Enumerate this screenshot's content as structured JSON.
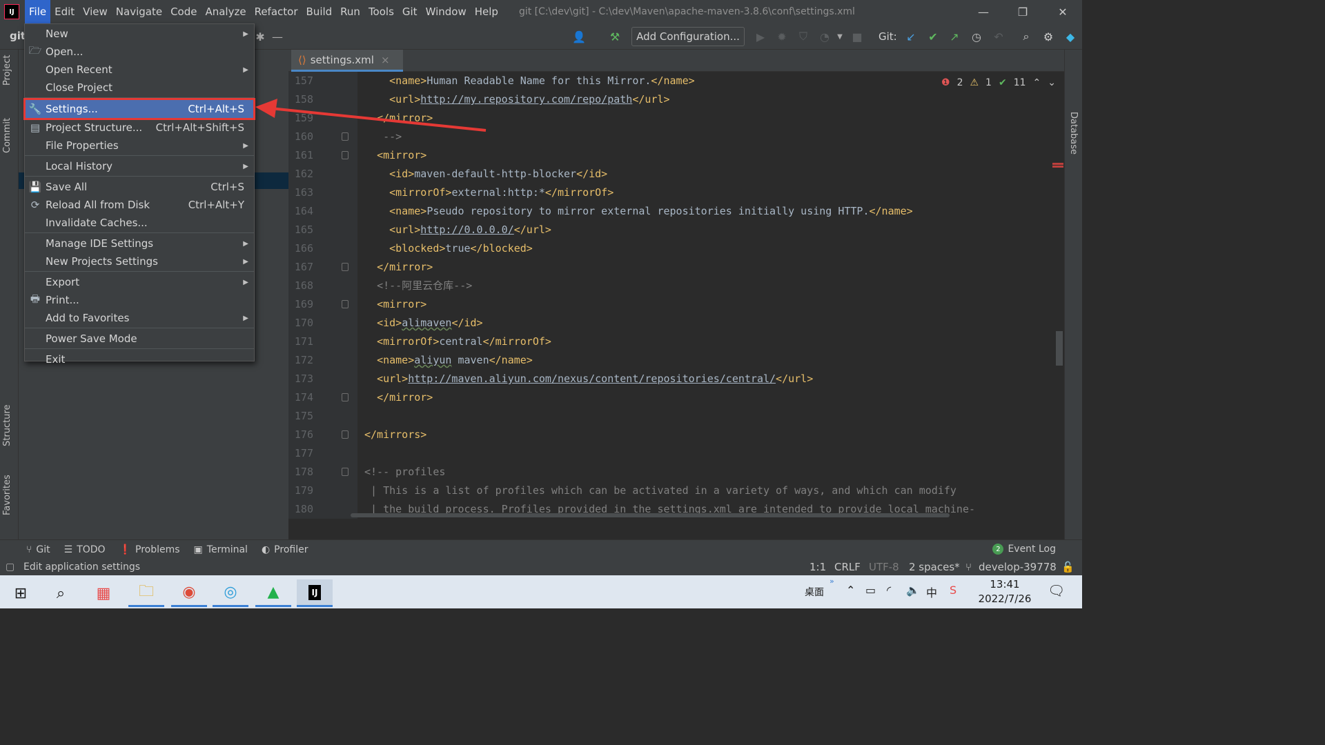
{
  "title_bar": {
    "menus": [
      "File",
      "Edit",
      "View",
      "Navigate",
      "Code",
      "Analyze",
      "Refactor",
      "Build",
      "Run",
      "Tools",
      "Git",
      "Window",
      "Help"
    ],
    "window_title": "git [C:\\dev\\git] - C:\\dev\\Maven\\apache-maven-3.8.6\\conf\\settings.xml",
    "minimize": "—",
    "restore": "❐",
    "close": "✕"
  },
  "toolbar": {
    "project": "git",
    "add_configuration": "Add Configuration...",
    "git_label": "Git:"
  },
  "left_tool_tabs": [
    "Project",
    "Commit",
    "Structure",
    "Favorites"
  ],
  "right_tool_tabs": [
    "Database"
  ],
  "editor_tab": {
    "label": "settings.xml",
    "close": "×"
  },
  "inspections": {
    "errors": "2",
    "warnings": "1",
    "ok": "11"
  },
  "editor": {
    "lines": [
      {
        "n": "157",
        "parts": [
          {
            "t": "    "
          },
          {
            "c": "t",
            "t": "<name>"
          },
          {
            "c": "v",
            "t": "Human Readable Name for this Mirror."
          },
          {
            "c": "t",
            "t": "</name>"
          }
        ]
      },
      {
        "n": "158",
        "parts": [
          {
            "t": "    "
          },
          {
            "c": "t",
            "t": "<url>"
          },
          {
            "c": "u",
            "t": "http://my.repository.com/repo/path"
          },
          {
            "c": "t",
            "t": "</url>"
          }
        ]
      },
      {
        "n": "159",
        "parts": [
          {
            "t": "  "
          },
          {
            "c": "t",
            "t": "</mirror>"
          }
        ]
      },
      {
        "n": "160",
        "fold": true,
        "parts": [
          {
            "t": "   "
          },
          {
            "c": "c",
            "t": "-->"
          }
        ]
      },
      {
        "n": "161",
        "fold": true,
        "parts": [
          {
            "t": "  "
          },
          {
            "c": "t",
            "t": "<mirror>"
          }
        ]
      },
      {
        "n": "162",
        "parts": [
          {
            "t": "    "
          },
          {
            "c": "t",
            "t": "<id>"
          },
          {
            "c": "v",
            "t": "maven-default-http-blocker"
          },
          {
            "c": "t",
            "t": "</id>"
          }
        ]
      },
      {
        "n": "163",
        "parts": [
          {
            "t": "    "
          },
          {
            "c": "t",
            "t": "<mirrorOf>"
          },
          {
            "c": "v",
            "t": "external:http:*"
          },
          {
            "c": "t",
            "t": "</mirrorOf>"
          }
        ]
      },
      {
        "n": "164",
        "parts": [
          {
            "t": "    "
          },
          {
            "c": "t",
            "t": "<name>"
          },
          {
            "c": "v",
            "t": "Pseudo repository to mirror external repositories initially using HTTP."
          },
          {
            "c": "t",
            "t": "</name>"
          }
        ]
      },
      {
        "n": "165",
        "parts": [
          {
            "t": "    "
          },
          {
            "c": "t",
            "t": "<url>"
          },
          {
            "c": "u",
            "t": "http://0.0.0.0/"
          },
          {
            "c": "t",
            "t": "</url>"
          }
        ]
      },
      {
        "n": "166",
        "parts": [
          {
            "t": "    "
          },
          {
            "c": "t",
            "t": "<blocked>"
          },
          {
            "c": "v",
            "t": "true"
          },
          {
            "c": "t",
            "t": "</blocked>"
          }
        ]
      },
      {
        "n": "167",
        "fold": true,
        "parts": [
          {
            "t": "  "
          },
          {
            "c": "t",
            "t": "</mirror>"
          }
        ]
      },
      {
        "n": "168",
        "parts": [
          {
            "t": "  "
          },
          {
            "c": "c",
            "t": "<!--阿里云仓库-->"
          }
        ]
      },
      {
        "n": "169",
        "fold": true,
        "parts": [
          {
            "t": "  "
          },
          {
            "c": "t",
            "t": "<mirror>"
          }
        ]
      },
      {
        "n": "170",
        "parts": [
          {
            "t": "  "
          },
          {
            "c": "t",
            "t": "<id>"
          },
          {
            "c": "v w",
            "t": "alimaven"
          },
          {
            "c": "t",
            "t": "</id>"
          }
        ]
      },
      {
        "n": "171",
        "parts": [
          {
            "t": "  "
          },
          {
            "c": "t",
            "t": "<mirrorOf>"
          },
          {
            "c": "v",
            "t": "central"
          },
          {
            "c": "t",
            "t": "</mirrorOf>"
          }
        ]
      },
      {
        "n": "172",
        "parts": [
          {
            "t": "  "
          },
          {
            "c": "t",
            "t": "<name>"
          },
          {
            "c": "v w",
            "t": "aliyun"
          },
          {
            "c": "v",
            "t": " maven"
          },
          {
            "c": "t",
            "t": "</name>"
          }
        ]
      },
      {
        "n": "173",
        "parts": [
          {
            "t": "  "
          },
          {
            "c": "t",
            "t": "<url>"
          },
          {
            "c": "u",
            "t": "http://maven.aliyun.com/nexus/content/repositories/central/"
          },
          {
            "c": "t",
            "t": "</url>"
          }
        ]
      },
      {
        "n": "174",
        "fold": true,
        "parts": [
          {
            "t": "  "
          },
          {
            "c": "t",
            "t": "</mirror>"
          }
        ]
      },
      {
        "n": "175",
        "parts": []
      },
      {
        "n": "176",
        "fold": true,
        "parts": [
          {
            "c": "t",
            "t": "</mirrors>"
          }
        ]
      },
      {
        "n": "177",
        "parts": []
      },
      {
        "n": "178",
        "fold": true,
        "parts": [
          {
            "c": "c",
            "t": "<!-- profiles"
          }
        ]
      },
      {
        "n": "179",
        "parts": [
          {
            "c": "c",
            "t": " | This is a list of profiles which can be activated in a variety of ways, and which can modify"
          }
        ]
      },
      {
        "n": "180",
        "parts": [
          {
            "c": "c",
            "t": " | the build process. Profiles provided in the settings.xml are intended to provide local machine-"
          }
        ]
      }
    ]
  },
  "file_menu": {
    "items": [
      {
        "label": "New",
        "submenu": true
      },
      {
        "label": "Open...",
        "icon": "folder-icon"
      },
      {
        "label": "Open Recent",
        "submenu": true
      },
      {
        "label": "Close Project"
      },
      {
        "sep": true
      },
      {
        "label": "Settings...",
        "shortcut": "Ctrl+Alt+S",
        "icon": "wrench-icon",
        "highlighted": true
      },
      {
        "label": "Project Structure...",
        "shortcut": "Ctrl+Alt+Shift+S",
        "icon": "project-structure-icon"
      },
      {
        "label": "File Properties",
        "submenu": true
      },
      {
        "sep": true
      },
      {
        "label": "Local History",
        "submenu": true
      },
      {
        "sep": true
      },
      {
        "label": "Save All",
        "shortcut": "Ctrl+S",
        "icon": "save-icon"
      },
      {
        "label": "Reload All from Disk",
        "shortcut": "Ctrl+Alt+Y",
        "icon": "reload-icon"
      },
      {
        "label": "Invalidate Caches..."
      },
      {
        "sep": true
      },
      {
        "label": "Manage IDE Settings",
        "submenu": true
      },
      {
        "label": "New Projects Settings",
        "submenu": true
      },
      {
        "sep": true
      },
      {
        "label": "Export",
        "submenu": true
      },
      {
        "label": "Print...",
        "icon": "print-icon"
      },
      {
        "label": "Add to Favorites",
        "submenu": true
      },
      {
        "sep": true
      },
      {
        "label": "Power Save Mode"
      },
      {
        "sep": true
      },
      {
        "label": "Exit"
      }
    ]
  },
  "tool_windows": {
    "items": [
      "Git",
      "TODO",
      "Problems",
      "Terminal",
      "Profiler"
    ],
    "event_log": "Event Log",
    "event_count": "2"
  },
  "status_bar": {
    "message": "Edit application settings",
    "position": "1:1",
    "line_sep": "CRLF",
    "encoding": "UTF-8",
    "indent": "2 spaces*",
    "branch": "develop-39778"
  },
  "taskbar": {
    "desktop_label": "桌面",
    "time": "13:41",
    "date": "2022/7/26",
    "ime": "中"
  },
  "colors": {
    "accent": "#2f65ca",
    "highlight_border": "#e53935",
    "arrow": "#e53935"
  }
}
